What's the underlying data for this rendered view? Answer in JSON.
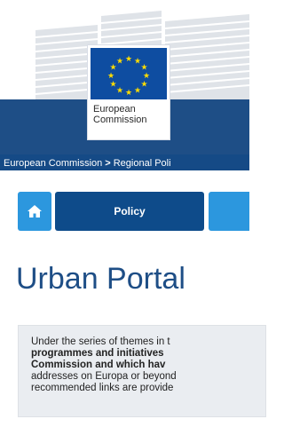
{
  "header": {
    "logo_line1": "European",
    "logo_line2": "Commission",
    "breadcrumb": {
      "item1": "European Commission",
      "separator": ">",
      "item2": "Regional Poli"
    }
  },
  "nav": {
    "home_icon": "home-icon",
    "policy_label": "Policy"
  },
  "page": {
    "title": "Urban Portal"
  },
  "intro": {
    "line1": "Under the series of themes in t",
    "line2": "programmes and initiatives",
    "line3": "Commission and which hav",
    "line4": "addresses on Europa or beyond",
    "line5": "recommended links are provide"
  },
  "colors": {
    "brand_blue": "#1e4e86",
    "nav_dark": "#0e4b8a",
    "nav_light": "#2c97de",
    "flag_blue": "#0e4da1",
    "star_yellow": "#ffdd00",
    "intro_bg": "#eaedf1"
  }
}
